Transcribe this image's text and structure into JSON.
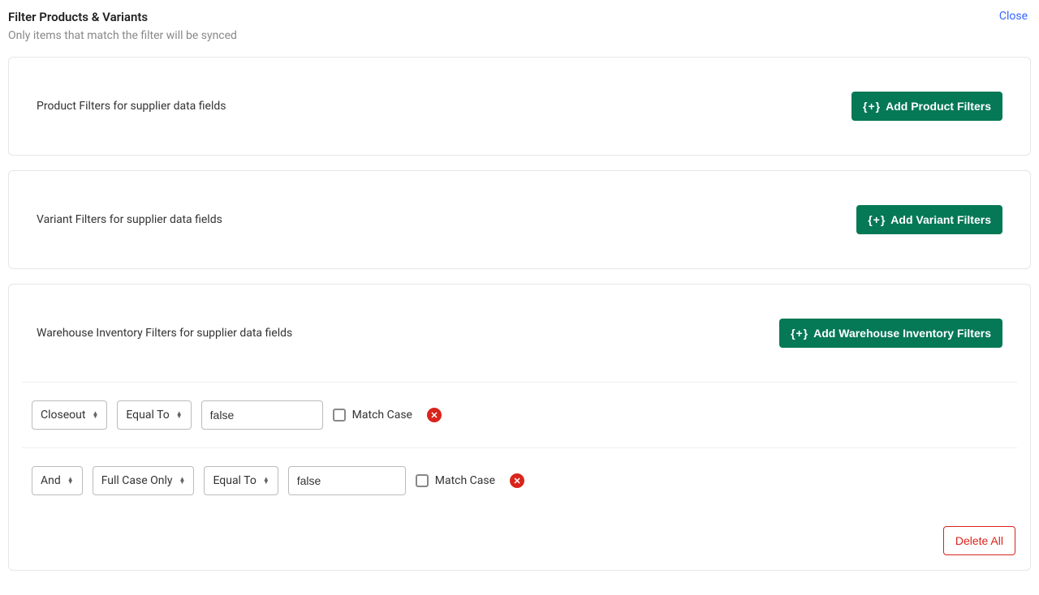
{
  "header": {
    "title": "Filter Products & Variants",
    "close": "Close",
    "subtitle": "Only items that match the filter will be synced"
  },
  "sections": {
    "product": {
      "label": "Product Filters for supplier data fields",
      "button": "Add Product Filters"
    },
    "variant": {
      "label": "Variant Filters for supplier data fields",
      "button": "Add Variant Filters"
    },
    "warehouse": {
      "label": "Warehouse Inventory Filters for supplier data fields",
      "button": "Add Warehouse Inventory Filters",
      "rows": [
        {
          "field": "Closeout",
          "operator": "Equal To",
          "value": "false",
          "match_case_label": "Match Case"
        },
        {
          "conjunction": "And",
          "field": "Full Case Only",
          "operator": "Equal To",
          "value": "false",
          "match_case_label": "Match Case"
        }
      ],
      "delete_all": "Delete All"
    }
  },
  "icons": {
    "plus_braces": "{+}"
  }
}
